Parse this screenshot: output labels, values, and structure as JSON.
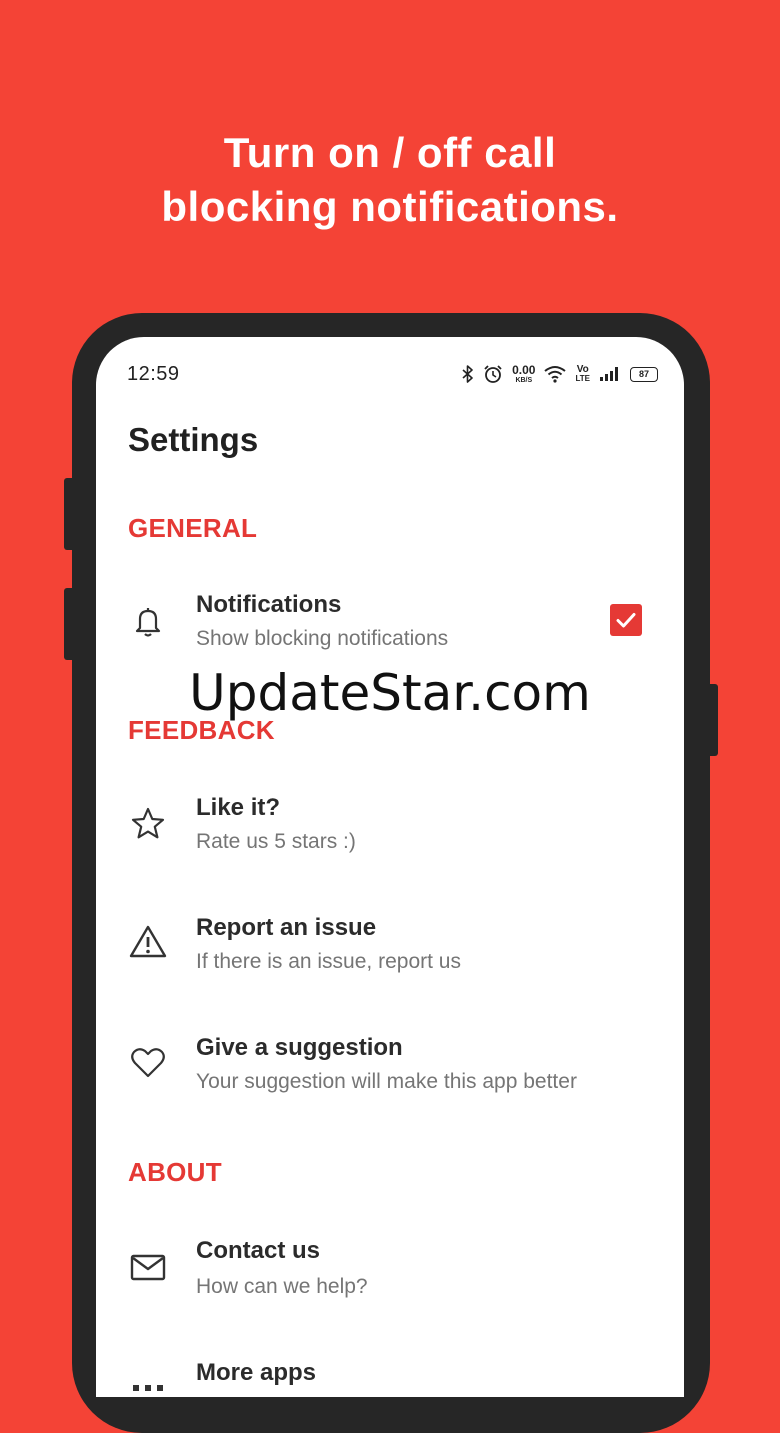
{
  "headline": {
    "line1": "Turn on / off call",
    "line2": "blocking notifications."
  },
  "status_bar": {
    "time": "12:59",
    "speed_value": "0.00",
    "speed_unit": "KB/S",
    "volte_top": "Vo",
    "volte_bottom": "LTE",
    "battery": "87"
  },
  "settings": {
    "title": "Settings",
    "sections": {
      "general": "GENERAL",
      "feedback": "FEEDBACK",
      "about": "ABOUT"
    },
    "notifications": {
      "title": "Notifications",
      "subtitle": "Show blocking notifications",
      "checked": true,
      "icon": "bell-icon"
    },
    "like": {
      "title": "Like it?",
      "subtitle": "Rate us 5 stars :)",
      "icon": "star-icon"
    },
    "report": {
      "title": "Report an issue",
      "subtitle": "If there is an issue, report us",
      "icon": "warning-icon"
    },
    "suggestion": {
      "title": "Give a suggestion",
      "subtitle": "Your suggestion will make this app better",
      "icon": "heart-icon"
    },
    "contact": {
      "title": "Contact us",
      "subtitle": "How can we help?",
      "icon": "mail-icon"
    },
    "more_apps": {
      "title": "More apps",
      "icon": "more-dots-icon"
    }
  },
  "watermark": "UpdateStar.com",
  "colors": {
    "accent": "#e53935",
    "background": "#f44336",
    "phone_frame": "#262626"
  }
}
